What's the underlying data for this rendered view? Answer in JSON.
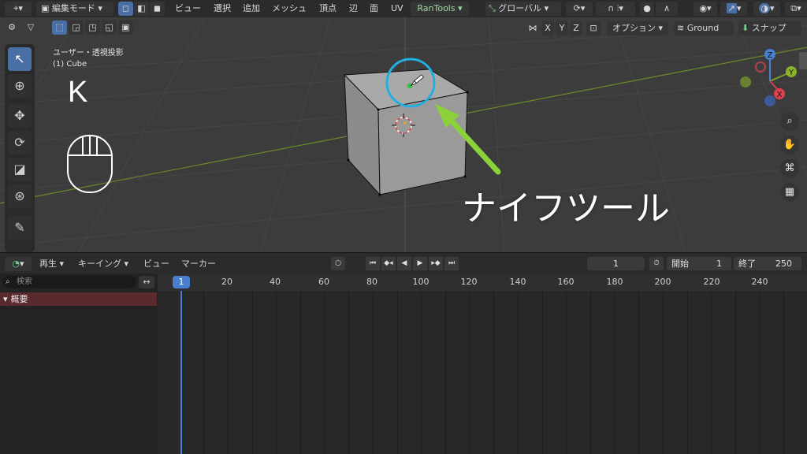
{
  "header": {
    "mode": "編集モード",
    "menus": [
      "ビュー",
      "選択",
      "追加",
      "メッシュ",
      "頂点",
      "辺",
      "面",
      "UV"
    ],
    "addon": "RanTools",
    "orientation": "グローバル"
  },
  "viewport_header": {
    "x": "X",
    "y": "Y",
    "z": "Z",
    "options": "オプション",
    "snap_target": "Ground",
    "snap": "スナップ"
  },
  "viewport": {
    "view_name": "ユーザー・透視投影",
    "object_name": "(1) Cube",
    "key_hint": "K",
    "callout": "ナイフツール",
    "gizmo": {
      "z": "Z",
      "y": "Y",
      "x": "X"
    }
  },
  "colors": {
    "accent_blue": "#4a6fa5",
    "callout_green": "#8ad13a",
    "callout_circle": "#22aee0",
    "summary_red": "#5a2a2e"
  },
  "timeline": {
    "playback": "再生",
    "keying": "キーイング",
    "view": "ビュー",
    "marker": "マーカー",
    "current_frame": "1",
    "start_label": "開始",
    "start_value": "1",
    "end_label": "終了",
    "end_value": "250",
    "search_placeholder": "検索",
    "summary": "概要",
    "ruler": [
      "1",
      "20",
      "40",
      "60",
      "80",
      "100",
      "120",
      "140",
      "160",
      "180",
      "200",
      "220",
      "240"
    ]
  }
}
